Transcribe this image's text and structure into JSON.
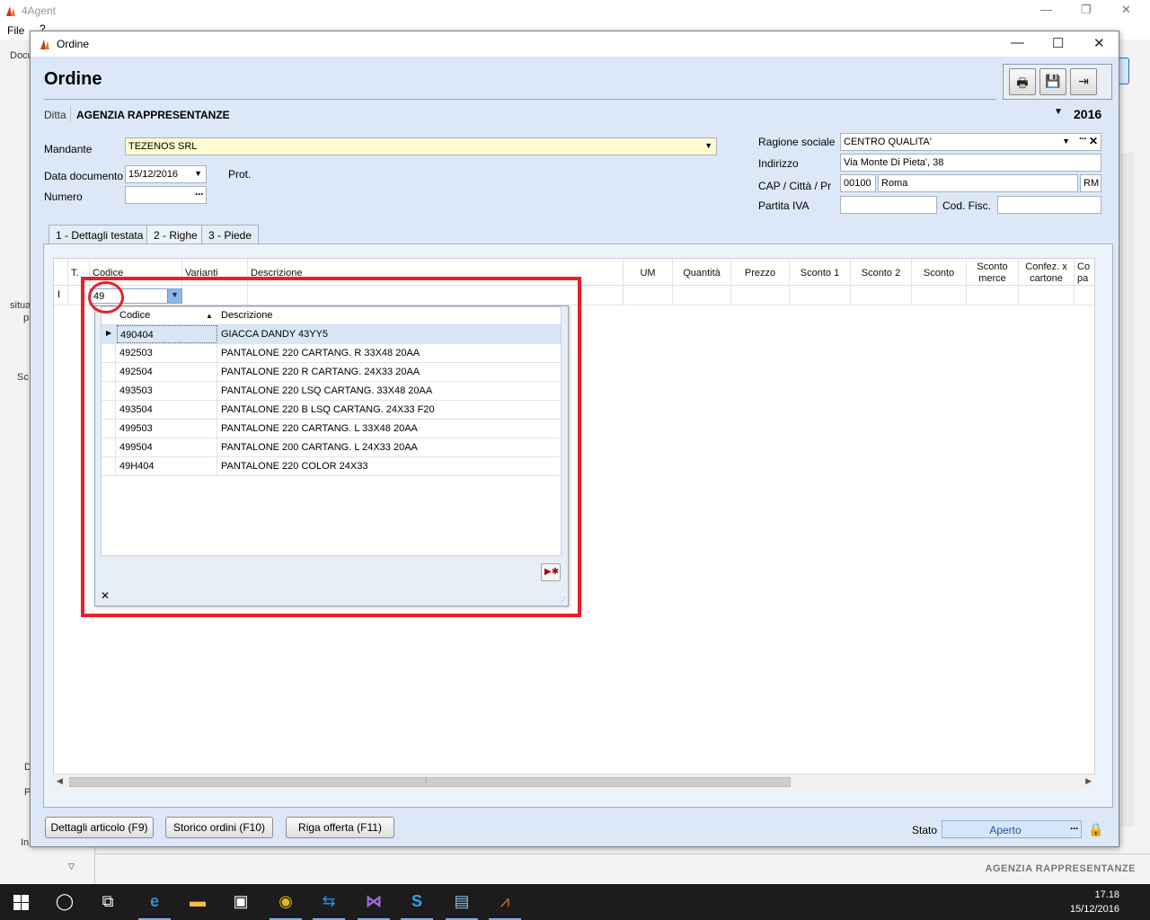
{
  "app": {
    "title": "4Agent",
    "menu": [
      "File",
      "?"
    ],
    "left_frag": [
      "Docu",
      "situa",
      "pr",
      "Sc",
      "D",
      "P",
      "In"
    ],
    "status_company": "AGENZIA RAPPRESENTANZE"
  },
  "dialog": {
    "title": "Ordine",
    "heading": "Ordine",
    "ditta_label": "Ditta",
    "ditta_value": "AGENZIA RAPPRESENTANZE",
    "year": "2016"
  },
  "form": {
    "mandante_label": "Mandante",
    "mandante_value": "TEZENOS SRL",
    "data_label": "Data documento",
    "data_value": "15/12/2016",
    "prot_label": "Prot.",
    "numero_label": "Numero",
    "numero_value": "",
    "ragione_label": "Ragione sociale",
    "ragione_value": "CENTRO QUALITA'",
    "indirizzo_label": "Indirizzo",
    "indirizzo_value": "Via Monte Di Pieta', 38",
    "cap_label": "CAP / Città / Pr",
    "cap_value": "00100",
    "citta_value": "Roma",
    "pr_value": "RM",
    "piva_label": "Partita IVA",
    "piva_value": "",
    "codfisc_label": "Cod. Fisc.",
    "codfisc_value": ""
  },
  "tabs": [
    {
      "label": "1 - Dettagli testata"
    },
    {
      "label": "2 - Righe"
    },
    {
      "label": "3 - Piede"
    }
  ],
  "grid": {
    "columns": [
      "T.",
      "Codice",
      "Varianti",
      "Descrizione",
      "UM",
      "Quantità",
      "Prezzo",
      "Sconto 1",
      "Sconto 2",
      "Sconto",
      "Sconto merce",
      "Confez. x cartone",
      "Co pa"
    ],
    "row_indicator": "I",
    "codice_input": "49"
  },
  "popup": {
    "col_codice": "Codice",
    "col_descrizione": "Descrizione",
    "rows": [
      {
        "codice": "490404",
        "descrizione": "GIACCA DANDY 43YY5"
      },
      {
        "codice": "492503",
        "descrizione": "PANTALONE 220 CARTANG. R 33X48 20AA"
      },
      {
        "codice": "492504",
        "descrizione": "PANTALONE 220 R CARTANG. 24X33 20AA"
      },
      {
        "codice": "493503",
        "descrizione": "PANTALONE 220 LSQ CARTANG. 33X48 20AA"
      },
      {
        "codice": "493504",
        "descrizione": "PANTALONE 220 B LSQ CARTANG. 24X33 F20"
      },
      {
        "codice": "499503",
        "descrizione": "PANTALONE 220 CARTANG. L 33X48 20AA"
      },
      {
        "codice": "499504",
        "descrizione": "PANTALONE 200 CARTANG. L 24X33 20AA"
      },
      {
        "codice": "49H404",
        "descrizione": "PANTALONE 220 COLOR 24X33"
      }
    ]
  },
  "buttons": {
    "dettagli": "Dettagli articolo (F9)",
    "storico": "Storico ordini (F10)",
    "riga": "Riga offerta (F11)"
  },
  "stato": {
    "label": "Stato",
    "value": "Aperto"
  },
  "taskbar": {
    "time": "17.18",
    "date": "15/12/2016"
  },
  "colors": {
    "highlight": "#e8202a",
    "dialog_bg": "#dce8f7",
    "mandante_bg": "#fffbd0",
    "stato_text": "#1a56a8"
  }
}
